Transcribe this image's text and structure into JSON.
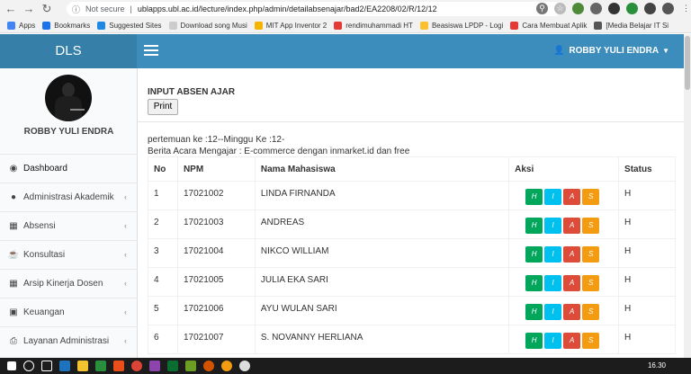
{
  "browser": {
    "security_label": "Not secure",
    "url": "ublapps.ubl.ac.id/lecture/index.php/admin/detailabsenajar/bad2/EA2208/02/R/12/12",
    "bookmarks": [
      "Apps",
      "Bookmarks",
      "Suggested Sites",
      "Download song Musi",
      "MIT App Inventor 2",
      "rendimuhammadi HT",
      "Beasiswa LPDP - Logi",
      "Cara Membuat Aplik",
      "[Media Belajar IT Si"
    ]
  },
  "header": {
    "logo": "DLS",
    "user": "ROBBY YULI ENDRA"
  },
  "sidebar": {
    "user_name": "ROBBY YULI ENDRA",
    "items": [
      {
        "label": "Dashboard"
      },
      {
        "label": "Administrasi Akademik"
      },
      {
        "label": "Absensi"
      },
      {
        "label": "Konsultasi"
      },
      {
        "label": "Arsip Kinerja Dosen"
      },
      {
        "label": "Keuangan"
      },
      {
        "label": "Layanan Administrasi"
      }
    ]
  },
  "main": {
    "title": "INPUT ABSEN AJAR",
    "print_label": "Print",
    "meeting_info": "pertemuan ke :12--Minggu Ke :12-",
    "berita_acara": "Berita Acara Mengajar : E-commerce dengan inmarket.id dan free",
    "columns": [
      "No",
      "NPM",
      "Nama Mahasiswa",
      "Aksi",
      "Status"
    ],
    "action_labels": [
      "H",
      "I",
      "A",
      "S"
    ],
    "rows": [
      {
        "no": "1",
        "npm": "17021002",
        "nama": "LINDA FIRNANDA",
        "status": "H"
      },
      {
        "no": "2",
        "npm": "17021003",
        "nama": "ANDREAS",
        "status": "H"
      },
      {
        "no": "3",
        "npm": "17021004",
        "nama": "NIKCO WILLIAM",
        "status": "H"
      },
      {
        "no": "4",
        "npm": "17021005",
        "nama": "JULIA EKA SARI",
        "status": "H"
      },
      {
        "no": "5",
        "npm": "17021006",
        "nama": "AYU WULAN SARI",
        "status": "H"
      },
      {
        "no": "6",
        "npm": "17021007",
        "nama": "S. NOVANNY HERLIANA",
        "status": "H"
      }
    ]
  },
  "taskbar": {
    "time": "16.30"
  },
  "colors": {
    "header": "#3c8dbc",
    "logo_bg": "#367fa9",
    "btn_h": "#00a65a",
    "btn_i": "#00c0ef",
    "btn_a": "#dd4b39",
    "btn_s": "#f39c12"
  }
}
